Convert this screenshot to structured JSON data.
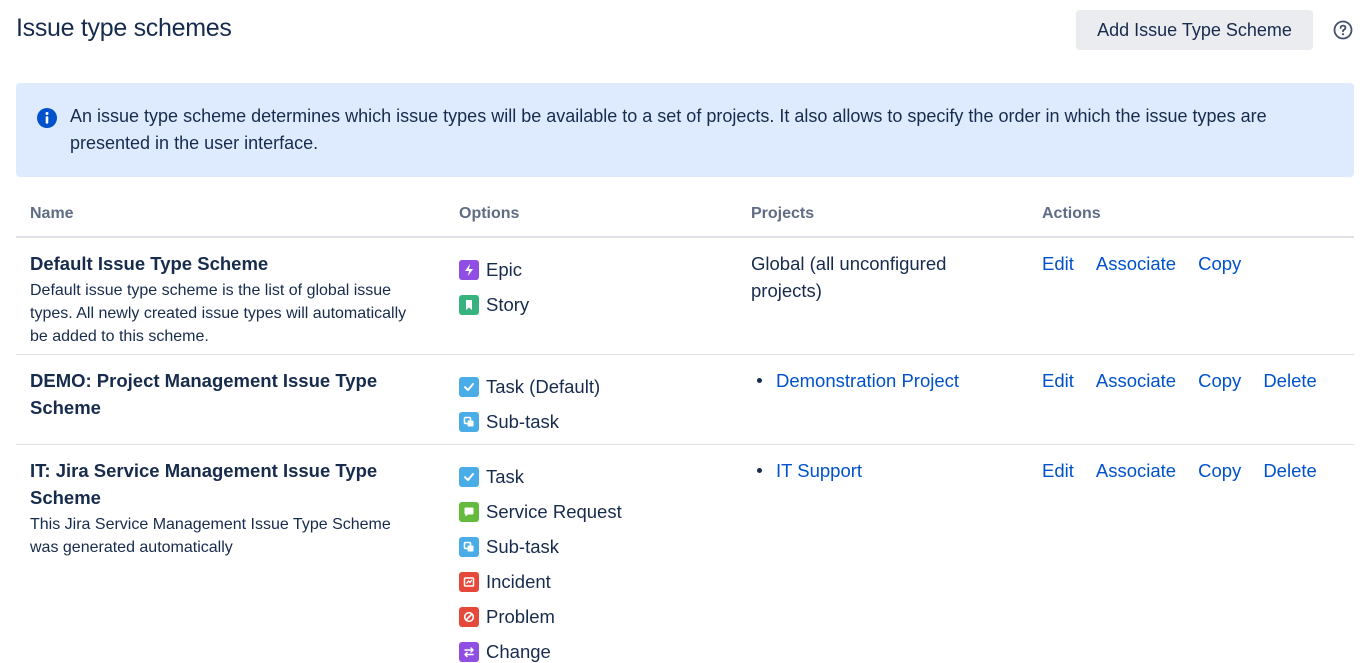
{
  "header": {
    "title": "Issue type schemes",
    "add_button_label": "Add Issue Type Scheme",
    "help_icon": "question-circle-icon"
  },
  "info": {
    "icon": "info-icon",
    "text": "An issue type scheme determines which issue types will be available to a set of projects. It also allows to specify the order in which the issue types are presented in the user interface."
  },
  "table": {
    "columns": [
      "Name",
      "Options",
      "Projects",
      "Actions"
    ],
    "rows": [
      {
        "name": "Default Issue Type Scheme",
        "description": "Default issue type scheme is the list of global issue types. All newly created issue types will automatically be added to this scheme.",
        "options": [
          {
            "label": "Epic",
            "icon": "epic-icon",
            "color": "#904ee2"
          },
          {
            "label": "Story",
            "icon": "story-icon",
            "color": "#36b37e"
          }
        ],
        "projects_text": "Global (all unconfigured projects)",
        "actions": [
          "Edit",
          "Associate",
          "Copy"
        ]
      },
      {
        "name": "DEMO: Project Management Issue Type Scheme",
        "description": "",
        "options": [
          {
            "label": "Task (Default)",
            "icon": "task-icon",
            "color": "#4bade8"
          },
          {
            "label": "Sub-task",
            "icon": "subtask-icon",
            "color": "#4bade8"
          }
        ],
        "projects": [
          "Demonstration Project"
        ],
        "actions": [
          "Edit",
          "Associate",
          "Copy",
          "Delete"
        ]
      },
      {
        "name": "IT: Jira Service Management Issue Type Scheme",
        "description": "This Jira Service Management Issue Type Scheme was generated automatically",
        "options": [
          {
            "label": "Task",
            "icon": "task-icon",
            "color": "#4bade8"
          },
          {
            "label": "Service Request",
            "icon": "service-request-icon",
            "color": "#63ba3c"
          },
          {
            "label": "Sub-task",
            "icon": "subtask-icon",
            "color": "#4bade8"
          },
          {
            "label": "Incident",
            "icon": "incident-icon",
            "color": "#e5493a"
          },
          {
            "label": "Problem",
            "icon": "problem-icon",
            "color": "#e5493a"
          },
          {
            "label": "Change",
            "icon": "change-icon",
            "color": "#904ee2"
          }
        ],
        "projects": [
          "IT Support"
        ],
        "actions": [
          "Edit",
          "Associate",
          "Copy",
          "Delete"
        ]
      }
    ]
  },
  "colors": {
    "link": "#0052cc",
    "text": "#172b4d",
    "banner_bg": "#deebff",
    "info_icon": "#0052cc"
  }
}
